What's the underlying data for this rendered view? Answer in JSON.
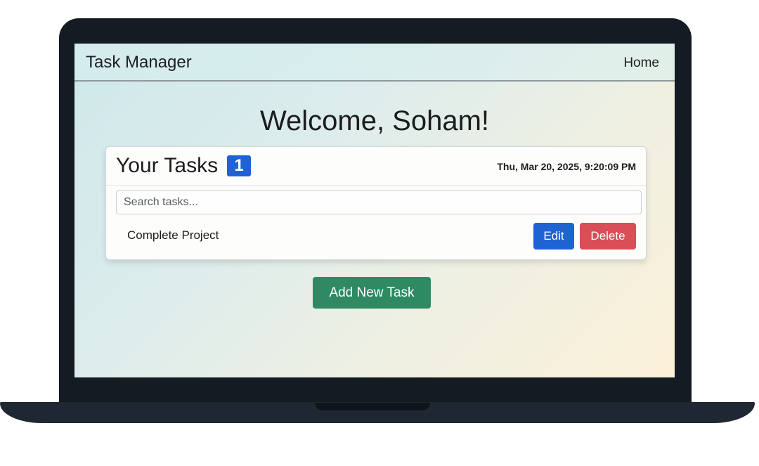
{
  "navbar": {
    "brand": "Task Manager",
    "home_link": "Home"
  },
  "welcome": "Welcome, Soham!",
  "tasks_card": {
    "title": "Your Tasks",
    "count": "1",
    "datetime": "Thu, Mar 20, 2025, 9:20:09 PM",
    "search_placeholder": "Search tasks...",
    "search_value": "",
    "items": [
      {
        "name": "Complete Project",
        "edit_label": "Edit",
        "delete_label": "Delete"
      }
    ]
  },
  "add_button_label": "Add New Task",
  "colors": {
    "primary": "#1f63d3",
    "danger": "#d94e57",
    "success": "#2f8a64",
    "laptop_frame": "#151b22"
  }
}
